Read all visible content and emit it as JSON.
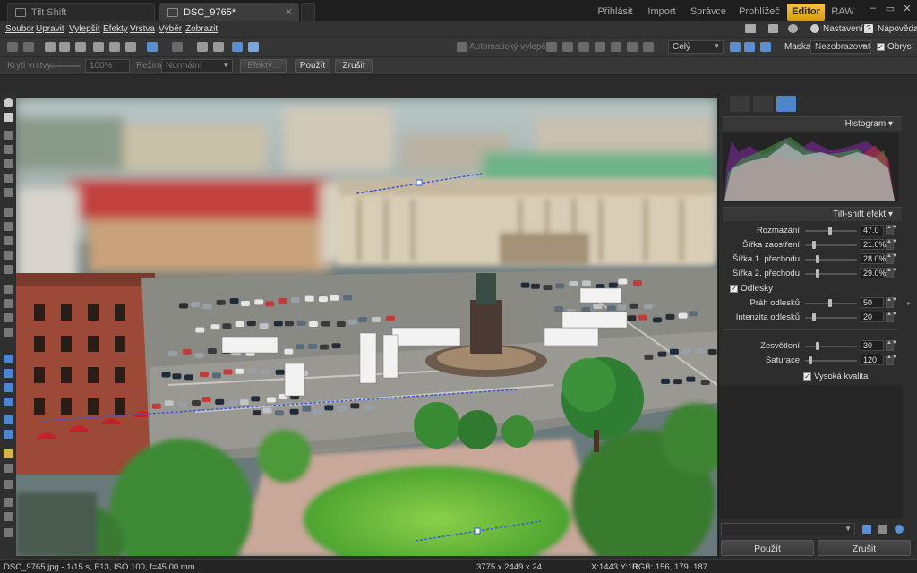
{
  "tabs": {
    "doc1": "Tilt Shift",
    "doc2": "DSC_9765*"
  },
  "modes": [
    "Přihlásit",
    "Import",
    "Správce",
    "Prohlížeč",
    "Editor",
    "RAW"
  ],
  "menu": [
    "Soubor",
    "Upravit",
    "Vylepšit",
    "Efekty",
    "Vrstva",
    "Výběr",
    "Zobrazit"
  ],
  "menu_right": {
    "settings": "Nastavení",
    "help": "Nápověda"
  },
  "toolbar": {
    "auto_enhance": "Automatický vylepšit",
    "zoom": "Celý",
    "mask_label": "Maska:",
    "mask_value": "Nezobrazovat",
    "outline_label": "Obrys"
  },
  "optbar": {
    "layer_opacity": "Krytí vrstvy:",
    "opacity_value": "100%",
    "mode_label": "Režim:",
    "mode_value": "Normální",
    "effects_btn": "Efekty...",
    "apply_btn": "Použít",
    "cancel_btn": "Zrušit"
  },
  "panel": {
    "histogram_title": "Histogram",
    "effect_title": "Tilt-shift efekt",
    "blur_label": "Rozmazání",
    "blur_value": "47.0",
    "focus_width_label": "Šířka zaostření",
    "focus_width_value": "21.0%",
    "transition1_label": "Šířka 1. přechodu",
    "transition1_value": "28.0%",
    "transition2_label": "Šířka 2. přechodu",
    "transition2_value": "29.0%",
    "reflections_label": "Odlesky",
    "refl_threshold_label": "Práh odlesků",
    "refl_threshold_value": "50",
    "refl_intensity_label": "Intenzita odlesků",
    "refl_intensity_value": "20",
    "brighten_label": "Zesvětlení",
    "brighten_value": "30",
    "saturation_label": "Saturace",
    "saturation_value": "120",
    "high_quality_label": "Vysoká kvalita",
    "apply": "Použít",
    "cancel": "Zrušit"
  },
  "status": {
    "file": "DSC_9765.jpg - 1/15 s, F13, ISO 100, f=45.00 mm",
    "dimensions": "3775 x 2449 x 24",
    "coords": "X:1443 Y:10",
    "rgb": "RGB: 156, 179, 187"
  },
  "colors": {
    "accent": "#f0b429",
    "panel": "#2d2d2d",
    "selection_blue": "#4f86c9"
  }
}
